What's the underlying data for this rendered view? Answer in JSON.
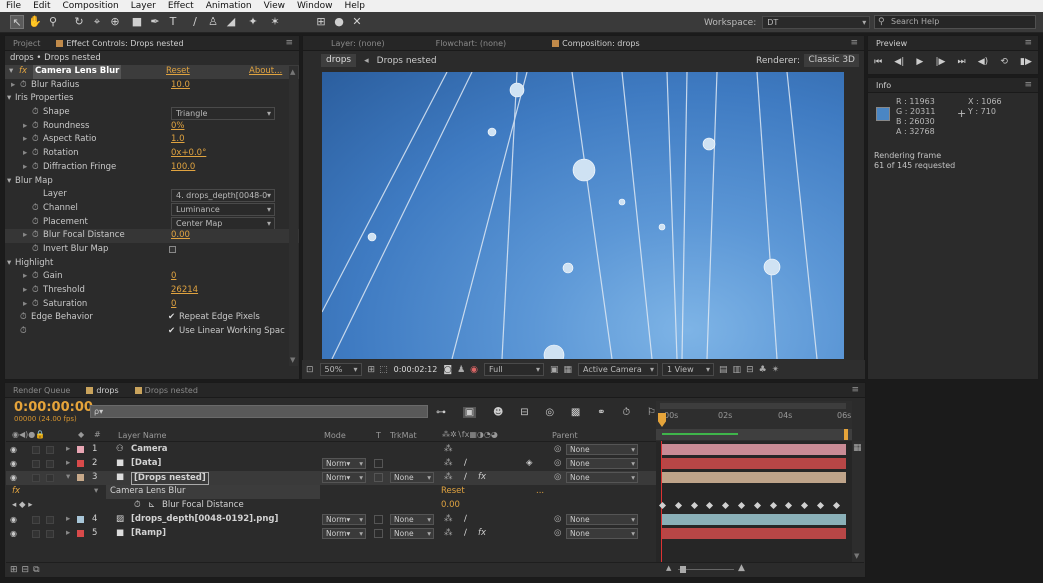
{
  "menu": [
    "File",
    "Edit",
    "Composition",
    "Layer",
    "Effect",
    "Animation",
    "View",
    "Window",
    "Help"
  ],
  "toolbar": {
    "workspace_label": "Workspace:",
    "workspace_value": "DT",
    "search_placeholder": "Search Help"
  },
  "left_panel": {
    "tabs": [
      "Project",
      "Effect Controls: Drops nested"
    ],
    "breadcrumb": "drops • Drops nested",
    "effect": {
      "name": "Camera Lens Blur",
      "reset": "Reset",
      "about": "About..."
    },
    "properties": [
      {
        "label": "Blur Radius",
        "value": "10.0",
        "kind": "link"
      },
      {
        "label": "Iris Properties",
        "kind": "group"
      },
      {
        "label": "Shape",
        "value": "Triangle",
        "kind": "dropdown"
      },
      {
        "label": "Roundness",
        "value": "0%",
        "kind": "link"
      },
      {
        "label": "Aspect Ratio",
        "value": "1.0",
        "kind": "link"
      },
      {
        "label": "Rotation",
        "value": "0x+0.0°",
        "kind": "link"
      },
      {
        "label": "Diffraction Fringe",
        "value": "100.0",
        "kind": "link"
      },
      {
        "label": "Blur Map",
        "kind": "group"
      },
      {
        "label": "Layer",
        "value": "4. drops_depth[0048-0",
        "kind": "dropdown"
      },
      {
        "label": "Channel",
        "value": "Luminance",
        "kind": "dropdown"
      },
      {
        "label": "Placement",
        "value": "Center Map",
        "kind": "dropdown"
      },
      {
        "label": "Blur Focal Distance",
        "value": "0.00",
        "kind": "link"
      },
      {
        "label": "Invert Blur Map",
        "value": "",
        "kind": "checkbox"
      },
      {
        "label": "Highlight",
        "kind": "group"
      },
      {
        "label": "Gain",
        "value": "0",
        "kind": "link"
      },
      {
        "label": "Threshold",
        "value": "26214",
        "kind": "link"
      },
      {
        "label": "Saturation",
        "value": "0",
        "kind": "link"
      },
      {
        "label": "Edge Behavior",
        "value": "Repeat Edge Pixels",
        "kind": "check"
      },
      {
        "label": "",
        "value": "Use Linear Working Spac",
        "kind": "check"
      }
    ]
  },
  "center_panel": {
    "tabs": [
      "Layer: (none)",
      "Flowchart: (none)",
      "Composition: drops"
    ],
    "comp_tabs": [
      "drops",
      "Drops nested"
    ],
    "renderer_label": "Renderer:",
    "renderer_value": "Classic 3D",
    "zoom": "50%",
    "timecode": "0:00:02:12",
    "resolution": "Full",
    "camera": "Active Camera",
    "views": "1 View"
  },
  "right_panel": {
    "preview_tab": "Preview",
    "info_tab": "Info",
    "info": {
      "r": "R : 11963",
      "g": "G : 20311",
      "b": "B : 26030",
      "a": "A : 32768",
      "x": "X : 1066",
      "y": "Y : 710",
      "swatch": "#4a86c4"
    },
    "render_status": "Rendering frame",
    "render_progress": "61 of 145 requested"
  },
  "timeline": {
    "tabs": [
      "Render Queue",
      "drops",
      "Drops nested"
    ],
    "current_time": "0:00:00:00",
    "fps": "00000 (24.00 fps)",
    "search_placeholder": "ρ▾",
    "ruler": [
      "00s",
      "02s",
      "04s",
      "06s"
    ],
    "columns": {
      "layer_name": "Layer Name",
      "mode": "Mode",
      "t": "T",
      "trkmat": "TrkMat",
      "parent": "Parent"
    },
    "layers": [
      {
        "num": "1",
        "name": "Camera",
        "color": "#e8a6b4",
        "mode": "",
        "trkmat": "",
        "parent": "None",
        "bar": "#c98b95"
      },
      {
        "num": "2",
        "name": "[Data]",
        "color": "#d84a4a",
        "mode": "Norm▾",
        "trkmat": "",
        "parent": "None",
        "bar": "#b84646"
      },
      {
        "num": "3",
        "name": "[Drops nested]",
        "color": "#c7a98a",
        "mode": "Norm▾",
        "trkmat": "None",
        "parent": "None",
        "bar": "#bfa48a"
      },
      {
        "num": "4",
        "name": "[drops_depth[0048-0192].png]",
        "color": "#a8c6d8",
        "mode": "Norm▾",
        "trkmat": "None",
        "parent": "None",
        "bar": "#8ab0b8"
      },
      {
        "num": "5",
        "name": "[Ramp]",
        "color": "#d84a4a",
        "mode": "Norm▾",
        "trkmat": "None",
        "parent": "None",
        "bar": "#b84646"
      }
    ],
    "effect_row": {
      "name": "Camera Lens Blur",
      "reset": "Reset",
      "dots": "..."
    },
    "prop_row": {
      "name": "Blur Focal Distance",
      "value": "0.00"
    }
  }
}
